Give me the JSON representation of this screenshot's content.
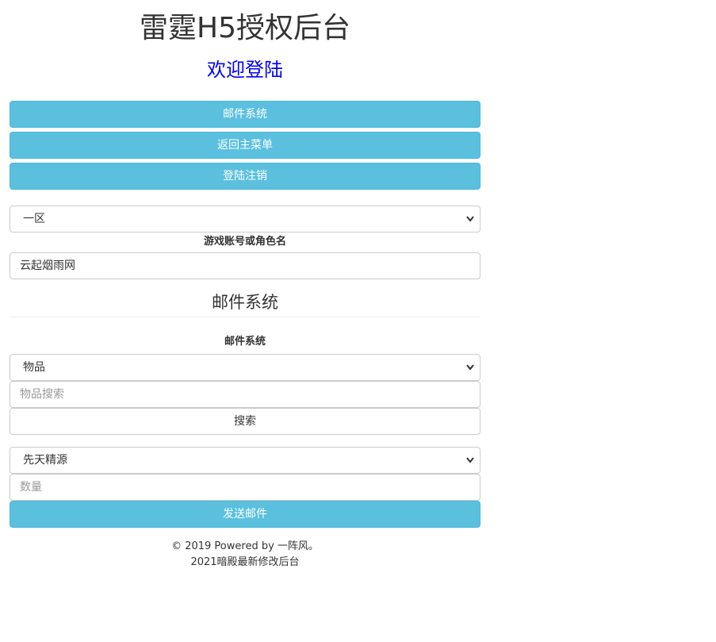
{
  "header": {
    "title": "雷霆H5授权后台",
    "welcome": "欢迎登陆"
  },
  "nav": {
    "mail_system_label": "邮件系统",
    "main_menu_label": "返回主菜单",
    "logout_label": "登陆注销"
  },
  "server_select": {
    "selected": "一区"
  },
  "account": {
    "label": "游戏账号或角色名",
    "value": "云起烟雨网"
  },
  "mail": {
    "section_title": "邮件系统",
    "form_label": "邮件系统",
    "type_select": "物品",
    "search_placeholder": "物品搜索",
    "search_button": "搜索",
    "item_select": "先天精源",
    "quantity_placeholder": "数量",
    "send_button": "发送邮件"
  },
  "footer": {
    "line1": "© 2019 Powered by 一阵风。",
    "line2": "2021暗殿最新修改后台"
  },
  "colors": {
    "info_button": "#5bc0de",
    "welcome_text": "#0000ff"
  }
}
